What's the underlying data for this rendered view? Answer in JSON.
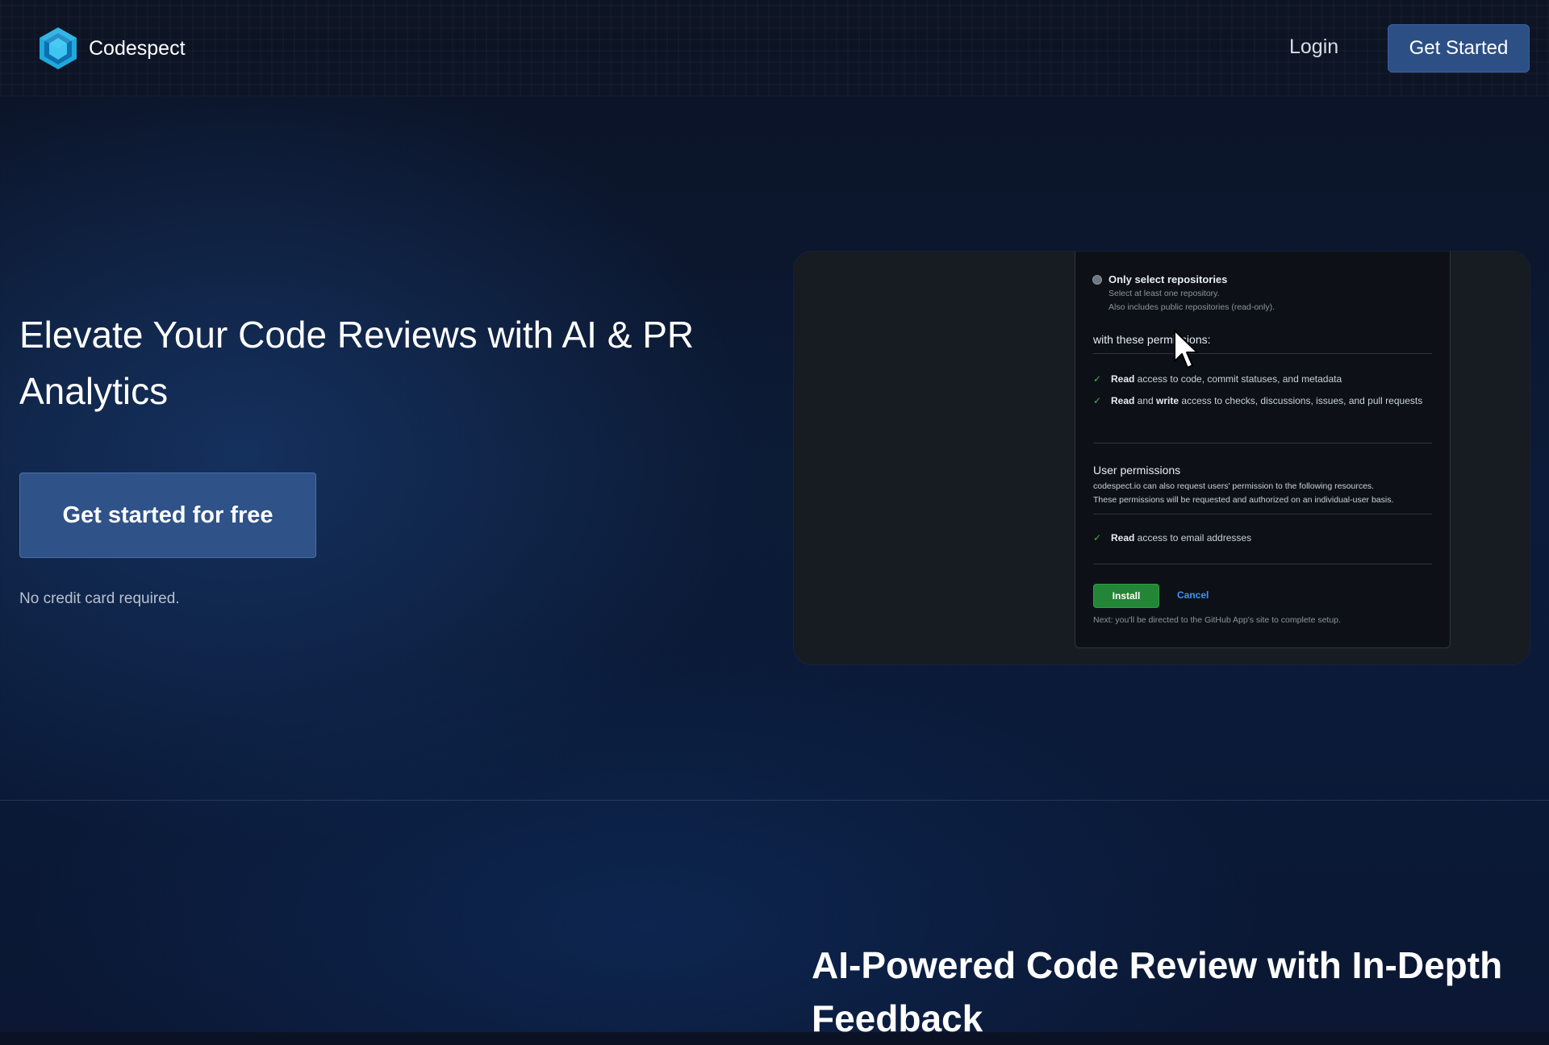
{
  "header": {
    "brand": "Codespect",
    "login": "Login",
    "cta": "Get Started"
  },
  "hero": {
    "title": "Elevate Your Code Reviews with AI & PR Analytics",
    "cta": "Get started for free",
    "note": "No credit card required."
  },
  "preview": {
    "option_label": "Only select repositories",
    "option_sub1": "Select at least one repository.",
    "option_sub2": "Also includes public repositories (read-only).",
    "permissions_heading": "with these permissions:",
    "repo_permissions": [
      {
        "bold": "Read",
        "text": " access to code, commit statuses, and metadata"
      },
      {
        "bold": "Read",
        "middle": " and ",
        "bold2": "write",
        "text": " access to checks, discussions, issues, and pull requests"
      }
    ],
    "user_permissions_title": "User permissions",
    "user_permissions_desc1": "codespect.io can also request users' permission to the following resources.",
    "user_permissions_desc2": "These permissions will be requested and authorized on an individual-user basis.",
    "user_permission": {
      "bold": "Read",
      "text": " access to email addresses"
    },
    "install": "Install",
    "cancel": "Cancel",
    "next_note": "Next: you'll be directed to the GitHub App's site to complete setup."
  },
  "features": {
    "title": "AI-Powered Code Review with In-Depth Feedback"
  },
  "colors": {
    "accent": "#2c4f86",
    "install_green": "#238636",
    "link_blue": "#4493f8",
    "logo_cyan": "#29b6e8"
  },
  "icons": {
    "logo": "hexagon-logo-icon",
    "check": "check-icon",
    "cursor": "mouse-pointer-icon"
  }
}
